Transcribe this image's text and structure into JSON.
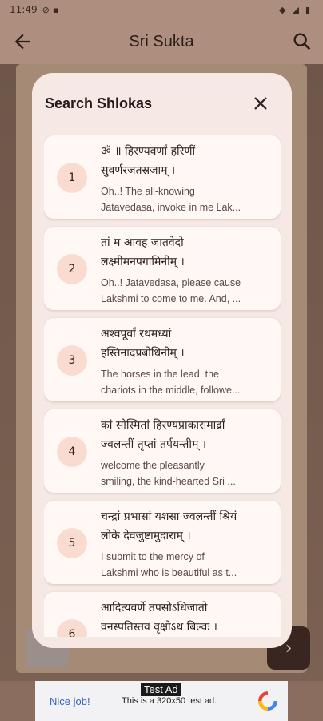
{
  "status_bar": {
    "time": "11:49"
  },
  "app_bar": {
    "title": "Sri Sukta",
    "back_icon": "arrow-left-icon",
    "search_icon": "search-icon"
  },
  "dialog": {
    "title": "Search Shlokas",
    "close_icon": "close-icon",
    "items": [
      {
        "number": "1",
        "sanskrit_line1": "ॐ ॥ हिरण्यवर्णां हरिणीं",
        "sanskrit_line2": "सुवर्णरजतस्रजाम् ।",
        "translation_line1": "Oh..! The all-knowing",
        "translation_line2": "Jatavedasa, invoke in me Lak..."
      },
      {
        "number": "2",
        "sanskrit_line1": "तां म आवह जातवेदो",
        "sanskrit_line2": "लक्ष्मीमनपगामिनीम् ।",
        "translation_line1": "Oh..! Jatavedasa, please cause",
        "translation_line2": "Lakshmi to come to me. And, ..."
      },
      {
        "number": "3",
        "sanskrit_line1": "अश्वपूर्वां रथमध्यां",
        "sanskrit_line2": "हस्तिनादप्रबोधिनीम् ।",
        "translation_line1": "The horses in the lead, the",
        "translation_line2": "chariots in the middle, followe..."
      },
      {
        "number": "4",
        "sanskrit_line1": "कां सोस्मितां हिरण्यप्राकारामार्द्रां",
        "sanskrit_line2": "ज्वलन्तीं तृप्तां तर्पयन्तीम् ।",
        "translation_line1": " welcome the pleasantly",
        "translation_line2": "smiling, the kind-hearted Sri ..."
      },
      {
        "number": "5",
        "sanskrit_line1": "चन्द्रां प्रभासां यशसा ज्वलन्तीं श्रियं",
        "sanskrit_line2": "लोके देवजुष्टामुदाराम् ।",
        "translation_line1": "I submit to the mercy of",
        "translation_line2": "Lakshmi who is beautiful as t..."
      },
      {
        "number": "6",
        "sanskrit_line1": "आदित्यवर्णे तपसोऽधिजातो",
        "sanskrit_line2": "वनस्पतिस्तव वृक्षोऽथ बिल्वः ।",
        "translation_line1": "",
        "translation_line2": ""
      }
    ]
  },
  "ad": {
    "tag": "Test Ad",
    "left_text": "Nice job!",
    "center_text": "This is a 320x50 test ad."
  },
  "colors": {
    "accent_circle": "#f9dccf",
    "dialog_bg": "#f6e8e3",
    "app_bar": "#ae8f7f"
  }
}
